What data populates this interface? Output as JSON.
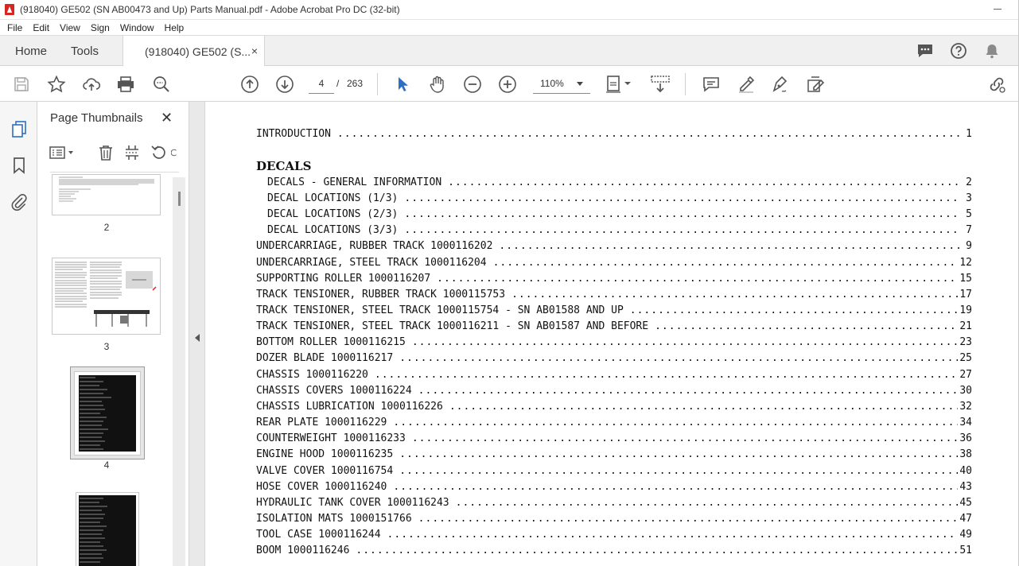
{
  "window": {
    "title": "(918040) GE502 (SN AB00473 and Up) Parts Manual.pdf - Adobe Acrobat Pro DC (32-bit)"
  },
  "menu": [
    "File",
    "Edit",
    "View",
    "Sign",
    "Window",
    "Help"
  ],
  "tabs": {
    "home": "Home",
    "tools": "Tools",
    "document": "(918040) GE502 (S...",
    "close": "×"
  },
  "toolbar": {
    "current_page": "4",
    "separator": "/",
    "total_pages": "263",
    "zoom": "110%"
  },
  "thumbnails": {
    "title": "Page Thumbnails",
    "close": "✕",
    "pages": [
      "2",
      "3",
      "4"
    ]
  },
  "toc": {
    "heading": "DECALS",
    "entries": [
      {
        "label": "INTRODUCTION",
        "page": "1",
        "indent": false
      },
      {
        "label": "DECALS - GENERAL INFORMATION",
        "page": "2",
        "indent": true
      },
      {
        "label": "DECAL LOCATIONS (1/3)",
        "page": "3",
        "indent": true
      },
      {
        "label": "DECAL LOCATIONS (2/3)",
        "page": "5",
        "indent": true
      },
      {
        "label": "DECAL LOCATIONS (3/3)",
        "page": "7",
        "indent": true
      },
      {
        "label": "UNDERCARRIAGE, RUBBER TRACK 1000116202",
        "page": "9",
        "indent": false
      },
      {
        "label": "UNDERCARRIAGE, STEEL TRACK 1000116204",
        "page": "12",
        "indent": false
      },
      {
        "label": "SUPPORTING ROLLER 1000116207",
        "page": "15",
        "indent": false
      },
      {
        "label": "TRACK TENSIONER, RUBBER TRACK 1000115753",
        "page": "17",
        "indent": false
      },
      {
        "label": "TRACK TENSIONER, STEEL TRACK 1000115754 - SN AB01588 AND UP",
        "page": "19",
        "indent": false
      },
      {
        "label": "TRACK TENSIONER, STEEL TRACK 1000116211 - SN AB01587 AND BEFORE",
        "page": "21",
        "indent": false
      },
      {
        "label": "BOTTOM ROLLER 1000116215",
        "page": "23",
        "indent": false
      },
      {
        "label": "DOZER BLADE 1000116217",
        "page": "25",
        "indent": false
      },
      {
        "label": "CHASSIS 1000116220",
        "page": "27",
        "indent": false
      },
      {
        "label": "CHASSIS COVERS 1000116224",
        "page": "30",
        "indent": false
      },
      {
        "label": "CHASSIS LUBRICATION 1000116226",
        "page": "32",
        "indent": false
      },
      {
        "label": "REAR PLATE 1000116229",
        "page": "34",
        "indent": false
      },
      {
        "label": "COUNTERWEIGHT 1000116233",
        "page": "36",
        "indent": false
      },
      {
        "label": "ENGINE HOOD 1000116235",
        "page": "38",
        "indent": false
      },
      {
        "label": "VALVE COVER 1000116754",
        "page": "40",
        "indent": false
      },
      {
        "label": "HOSE COVER 1000116240",
        "page": "43",
        "indent": false
      },
      {
        "label": "HYDRAULIC TANK COVER 1000116243",
        "page": "45",
        "indent": false
      },
      {
        "label": "ISOLATION MATS 1000151766",
        "page": "47",
        "indent": false
      },
      {
        "label": "TOOL CASE 1000116244",
        "page": "49",
        "indent": false
      },
      {
        "label": "BOOM 1000116246",
        "page": "51",
        "indent": false
      }
    ]
  },
  "icons": {
    "save": "save-icon",
    "bookmark": "star-icon",
    "upload": "upload-icon",
    "print": "print-icon",
    "search": "zoom-search-icon",
    "prev": "page-up-icon",
    "next": "page-down-icon",
    "select": "select-cursor-icon",
    "hand": "hand-icon",
    "zoom_out": "zoom-out-icon",
    "zoom_in": "zoom-in-icon"
  },
  "colors": {
    "accent": "#2d6fc0",
    "acrobat_red": "#d7261f"
  }
}
